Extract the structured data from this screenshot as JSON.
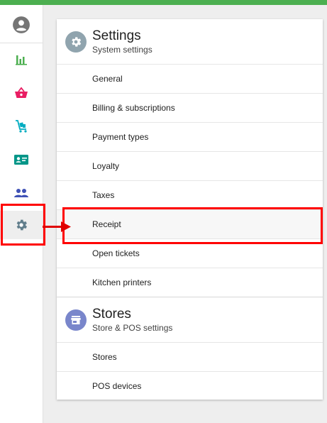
{
  "colors": {
    "topbar": "#4caf50",
    "highlight": "#ff0000",
    "settings_icon_bg": "#90a4ae",
    "stores_icon_bg": "#7986cb"
  },
  "sidebar": {
    "items": [
      {
        "name": "account-icon",
        "color": "#757575"
      },
      {
        "name": "reports-icon",
        "color": "#4caf50"
      },
      {
        "name": "items-basket-icon",
        "color": "#e91e63"
      },
      {
        "name": "inventory-cart-icon",
        "color": "#00acc1"
      },
      {
        "name": "employees-card-icon",
        "color": "#009688"
      },
      {
        "name": "customers-people-icon",
        "color": "#3f51b5"
      },
      {
        "name": "settings-gear-icon",
        "color": "#607d8b",
        "active": true
      }
    ]
  },
  "settings": {
    "title": "Settings",
    "subtitle": "System settings",
    "items": [
      "General",
      "Billing & subscriptions",
      "Payment types",
      "Loyalty",
      "Taxes",
      "Receipt",
      "Open tickets",
      "Kitchen printers"
    ],
    "selected_item": "Receipt"
  },
  "stores": {
    "title": "Stores",
    "subtitle": "Store & POS settings",
    "items": [
      "Stores",
      "POS devices"
    ]
  }
}
